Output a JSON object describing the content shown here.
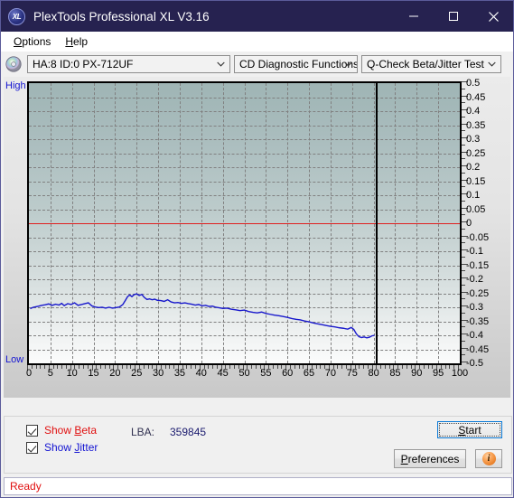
{
  "window": {
    "title": "PlexTools Professional XL V3.16",
    "icon": "XL",
    "controls": {
      "minimize": "minimize-icon",
      "maximize": "maximize-icon",
      "close": "close-icon"
    }
  },
  "menubar": {
    "items": [
      {
        "label": "Options",
        "accel": "O"
      },
      {
        "label": "Help",
        "accel": "H"
      }
    ]
  },
  "toolbar": {
    "disc_icon": "disc-icon",
    "drive_select": {
      "value": "HA:8 ID:0  PX-712UF"
    },
    "function_select": {
      "value": "CD Diagnostic Functions"
    },
    "test_select": {
      "value": "Q-Check Beta/Jitter Test"
    }
  },
  "chart_labels": {
    "high": "High",
    "low": "Low"
  },
  "chart_data": {
    "type": "line",
    "title": "Q-Check Beta/Jitter Test",
    "xlabel": "",
    "ylabel": "",
    "xlim": [
      0,
      100
    ],
    "ylim": [
      -0.5,
      0.5
    ],
    "grid": true,
    "legend": "none",
    "x_ticks": [
      0,
      5,
      10,
      15,
      20,
      25,
      30,
      35,
      40,
      45,
      50,
      55,
      60,
      65,
      70,
      75,
      80,
      85,
      90,
      95,
      100
    ],
    "y_ticks": [
      0.5,
      0.45,
      0.4,
      0.35,
      0.3,
      0.25,
      0.2,
      0.15,
      0.1,
      0.05,
      0,
      -0.05,
      -0.1,
      -0.15,
      -0.2,
      -0.25,
      -0.3,
      -0.35,
      -0.4,
      -0.45,
      -0.5
    ],
    "annotations": [
      {
        "name": "zero-reference-line",
        "type": "hline",
        "y": 0,
        "color": "#e02020"
      },
      {
        "name": "end-of-data-marker",
        "type": "vline",
        "x": 80.5,
        "color": "#000000"
      }
    ],
    "series": [
      {
        "name": "Jitter",
        "color": "#1818cc",
        "x": [
          0.3,
          1.0,
          1.6,
          2.2,
          3.0,
          3.8,
          4.6,
          5.4,
          6.2,
          7.0,
          7.6,
          8.2,
          9.0,
          9.8,
          10.6,
          11.4,
          12.2,
          13.0,
          13.8,
          14.6,
          15.4,
          16.2,
          17.0,
          17.8,
          18.6,
          19.4,
          20.2,
          21.0,
          21.8,
          22.4,
          22.9,
          23.4,
          23.9,
          24.4,
          25.0,
          25.6,
          26.2,
          26.8,
          27.4,
          28.0,
          28.6,
          29.2,
          29.8,
          30.6,
          31.4,
          32.2,
          33.0,
          33.8,
          34.6,
          35.4,
          36.2,
          37.0,
          37.8,
          38.6,
          39.4,
          40.2,
          41.0,
          41.8,
          42.6,
          43.4,
          44.2,
          45.0,
          46.0,
          47.0,
          48.0,
          49.0,
          50.0,
          51.0,
          52.0,
          53.0,
          54.0,
          55.0,
          56.0,
          57.0,
          58.0,
          59.0,
          60.0,
          61.0,
          62.0,
          63.0,
          64.0,
          65.0,
          66.0,
          67.0,
          68.0,
          69.0,
          70.0,
          71.0,
          72.0,
          73.0,
          74.0,
          74.8,
          75.4,
          76.0,
          76.6,
          77.2,
          77.8,
          78.4,
          79.0,
          79.6,
          80.2
        ],
        "y": [
          -0.305,
          -0.3,
          -0.298,
          -0.296,
          -0.293,
          -0.291,
          -0.288,
          -0.293,
          -0.289,
          -0.292,
          -0.286,
          -0.294,
          -0.287,
          -0.29,
          -0.284,
          -0.293,
          -0.29,
          -0.287,
          -0.284,
          -0.295,
          -0.299,
          -0.301,
          -0.3,
          -0.303,
          -0.3,
          -0.303,
          -0.301,
          -0.299,
          -0.29,
          -0.275,
          -0.262,
          -0.256,
          -0.262,
          -0.255,
          -0.252,
          -0.258,
          -0.254,
          -0.265,
          -0.272,
          -0.27,
          -0.273,
          -0.271,
          -0.275,
          -0.276,
          -0.279,
          -0.273,
          -0.281,
          -0.284,
          -0.283,
          -0.286,
          -0.284,
          -0.287,
          -0.289,
          -0.292,
          -0.29,
          -0.295,
          -0.293,
          -0.297,
          -0.296,
          -0.3,
          -0.302,
          -0.304,
          -0.303,
          -0.307,
          -0.309,
          -0.312,
          -0.31,
          -0.315,
          -0.318,
          -0.32,
          -0.317,
          -0.322,
          -0.325,
          -0.328,
          -0.33,
          -0.333,
          -0.336,
          -0.34,
          -0.343,
          -0.345,
          -0.349,
          -0.352,
          -0.356,
          -0.359,
          -0.362,
          -0.365,
          -0.368,
          -0.37,
          -0.373,
          -0.375,
          -0.378,
          -0.372,
          -0.379,
          -0.395,
          -0.405,
          -0.408,
          -0.406,
          -0.409,
          -0.407,
          -0.402,
          -0.4
        ]
      }
    ]
  },
  "controls": {
    "show_beta": {
      "label": "Show Beta",
      "accel": "B",
      "checked": true
    },
    "show_jitter": {
      "label": "Show Jitter",
      "accel": "J",
      "checked": true
    },
    "lba_label": "LBA:",
    "lba_value": "359845",
    "start_button": {
      "label": "Start",
      "accel": "S"
    },
    "preferences_button": {
      "label": "Preferences",
      "accel": "P"
    },
    "info_button": {
      "glyph": "i"
    }
  },
  "statusbar": {
    "text": "Ready"
  },
  "colors": {
    "titlebar": "#262250",
    "curve": "#1818cc",
    "zero_line": "#e02020",
    "beta_text": "#e01010",
    "jitter_text": "#1414d2",
    "status_text": "#e01010",
    "accent_focus": "#0c7ad6"
  }
}
